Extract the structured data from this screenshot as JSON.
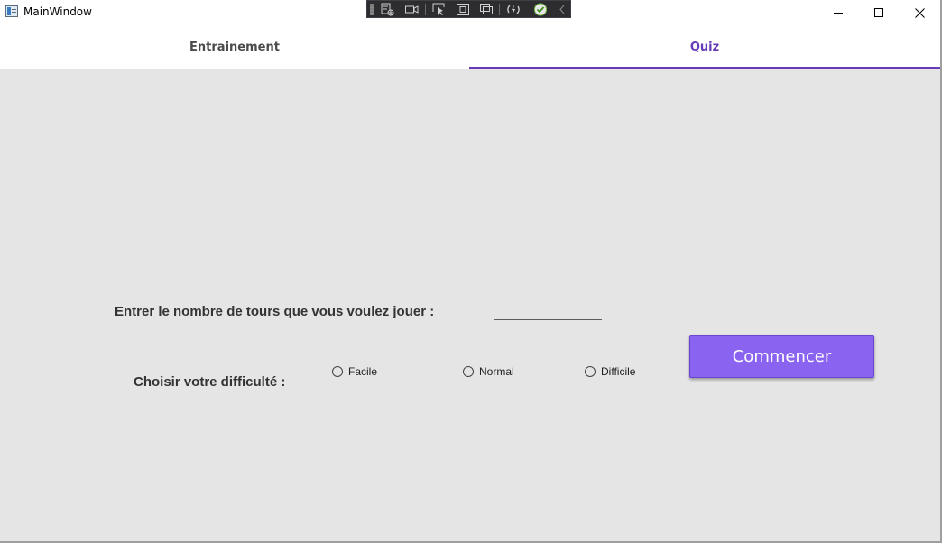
{
  "window": {
    "title": "MainWindow",
    "controls": [
      "minimize",
      "maximize",
      "close"
    ]
  },
  "debug_toolbar": {
    "icons": [
      "live-visual-tree-icon",
      "record-icon",
      "select-element-icon",
      "layout-adorner-icon",
      "track-focus-icon",
      "hot-reload-icon",
      "check-icon",
      "collapse-icon"
    ]
  },
  "tabs": [
    {
      "label": "Entrainement",
      "selected": false
    },
    {
      "label": "Quiz",
      "selected": true
    }
  ],
  "quiz": {
    "tours_label": "Entrer le nombre de tours que vous voulez jouer :",
    "tours_value": "",
    "difficulty_label": "Choisir votre difficulté :",
    "difficulty_options": [
      {
        "label": "Facile",
        "checked": false
      },
      {
        "label": "Normal",
        "checked": false
      },
      {
        "label": "Difficile",
        "checked": false
      }
    ],
    "start_button": "Commencer"
  },
  "colors": {
    "accent": "#673ab7",
    "button": "#8a63f0",
    "content_bg": "#e5e5e5"
  }
}
